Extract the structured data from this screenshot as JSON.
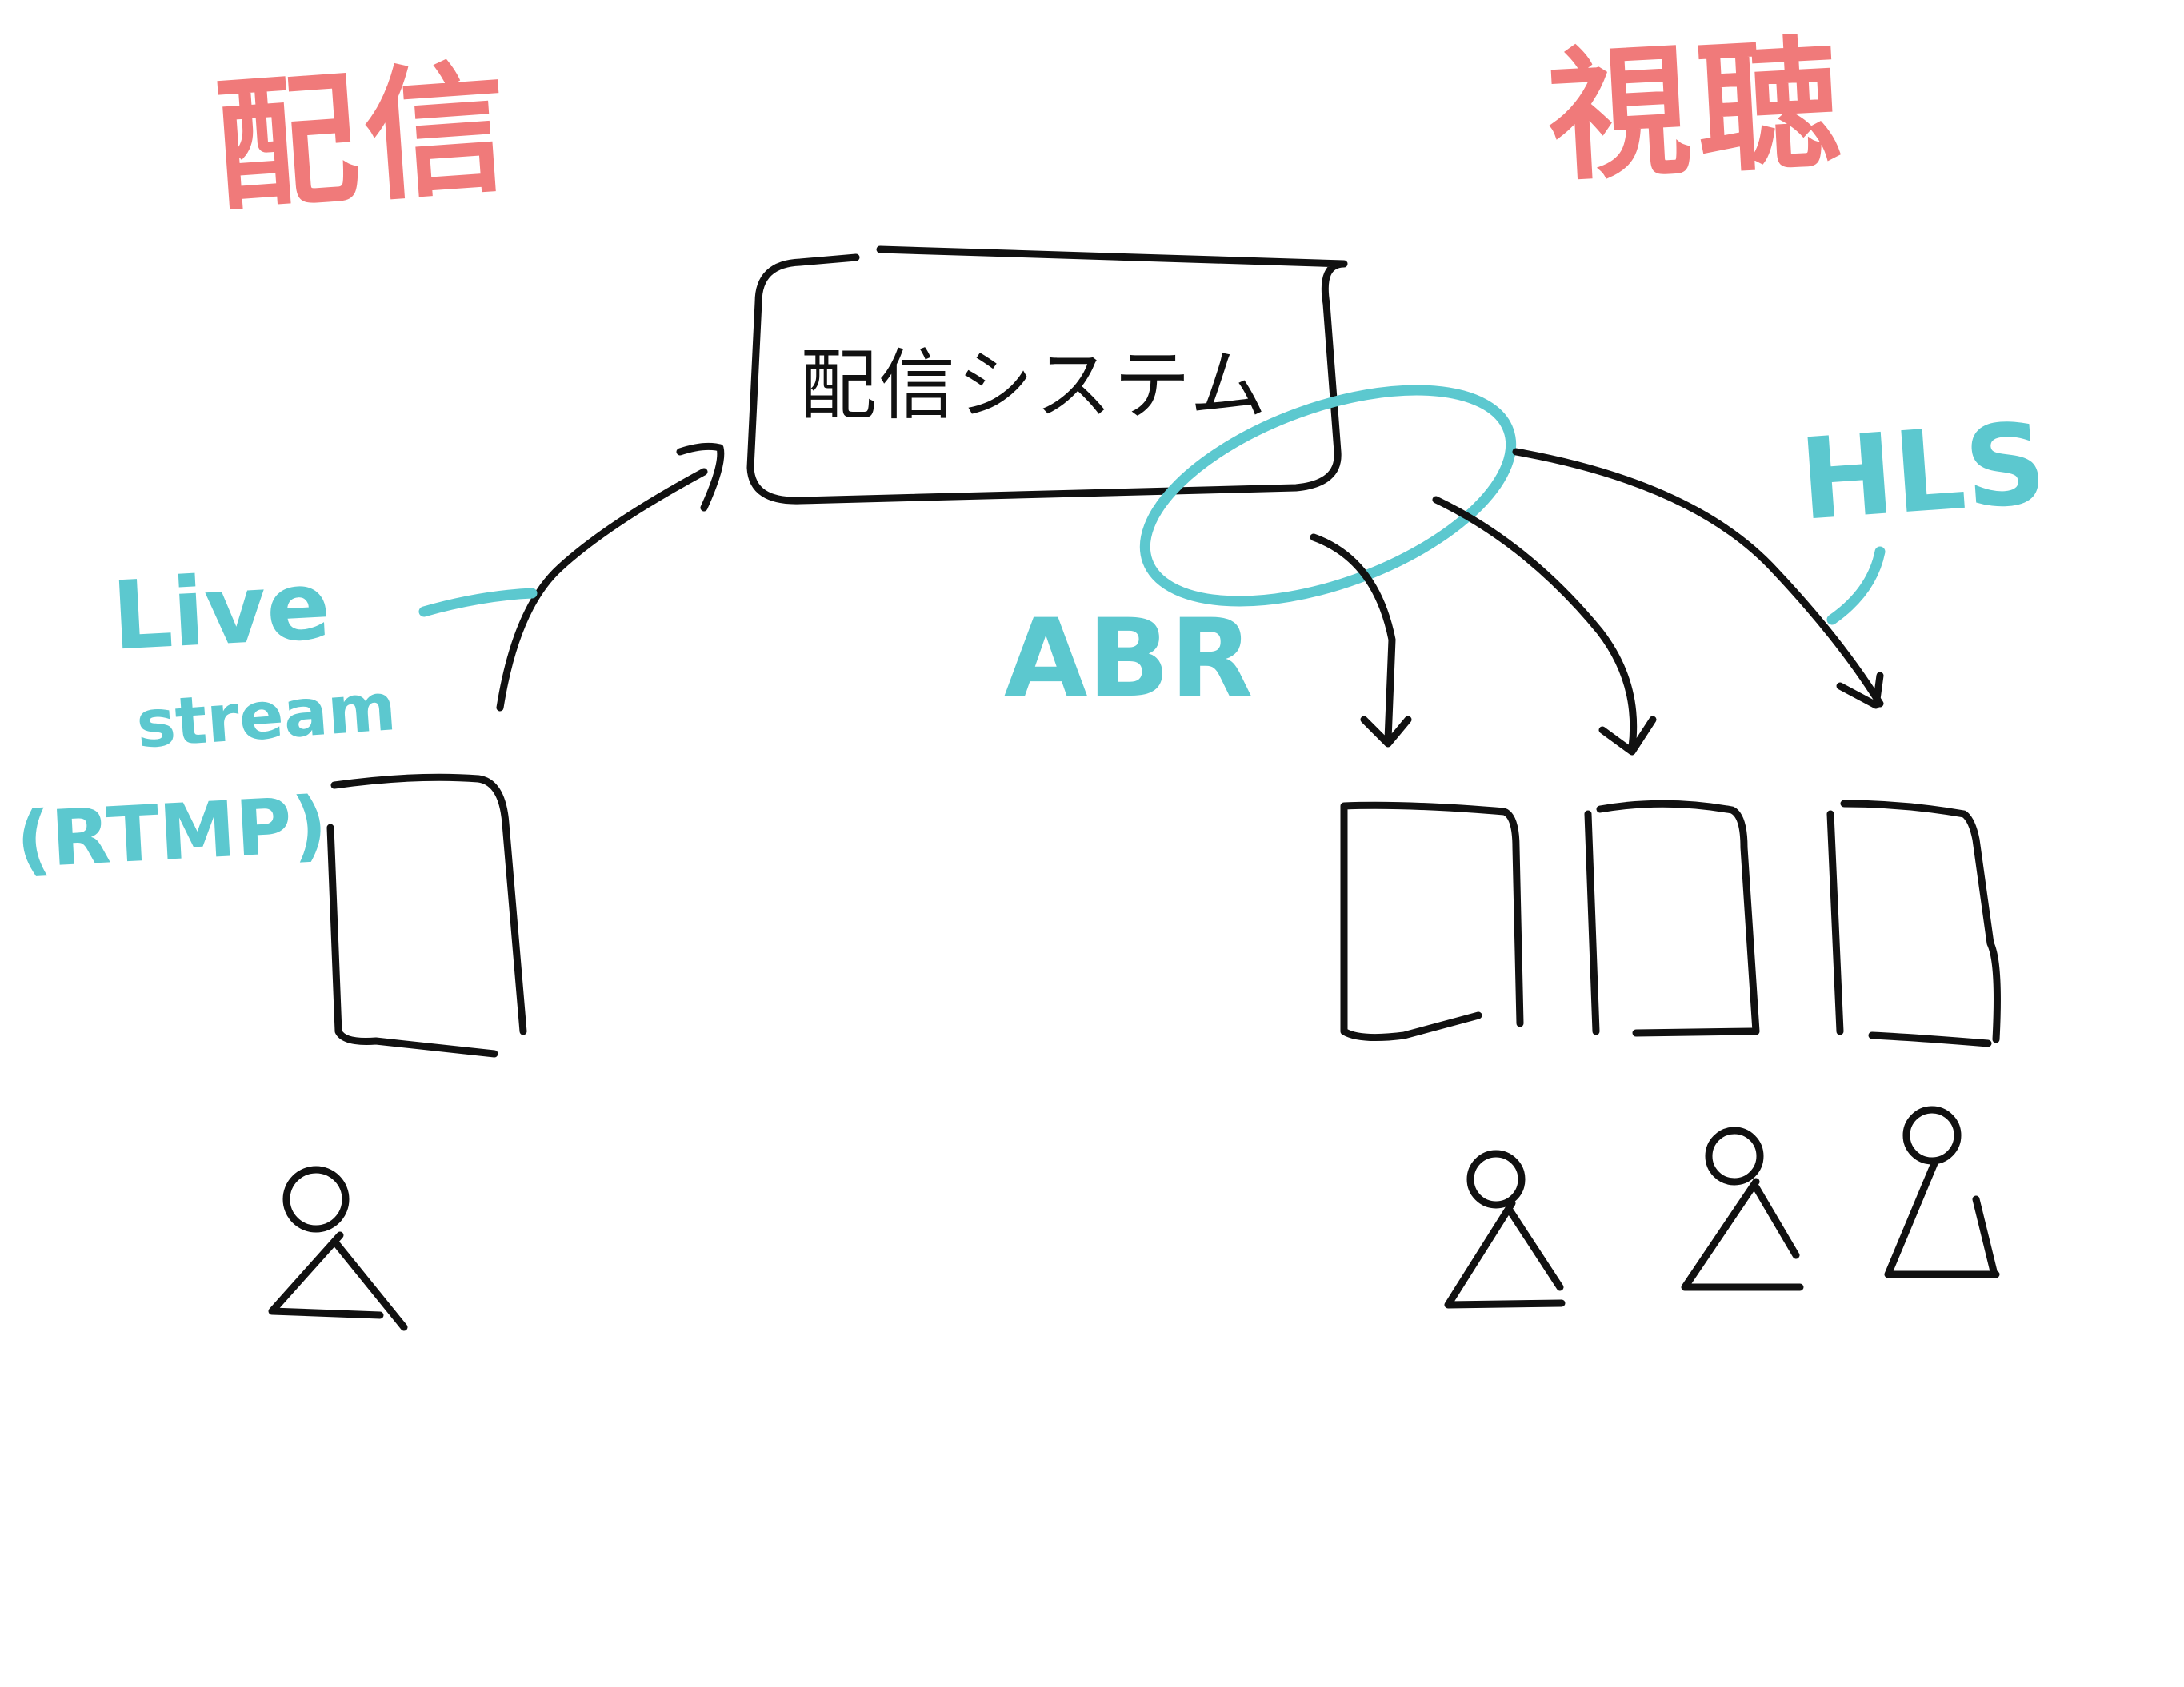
{
  "headings": {
    "left": "配信",
    "right": "視聴"
  },
  "system_box": {
    "label": "配信システム"
  },
  "annotations": {
    "live_stream_line1": "Live",
    "live_stream_line2": "stream",
    "rtmp": "(RTMP)",
    "abr": "ABR",
    "hls": "HLS"
  },
  "colors": {
    "heading": "#f07a7a",
    "annotation": "#5cc8cf",
    "ink": "#111111",
    "background": "#ffffff"
  }
}
